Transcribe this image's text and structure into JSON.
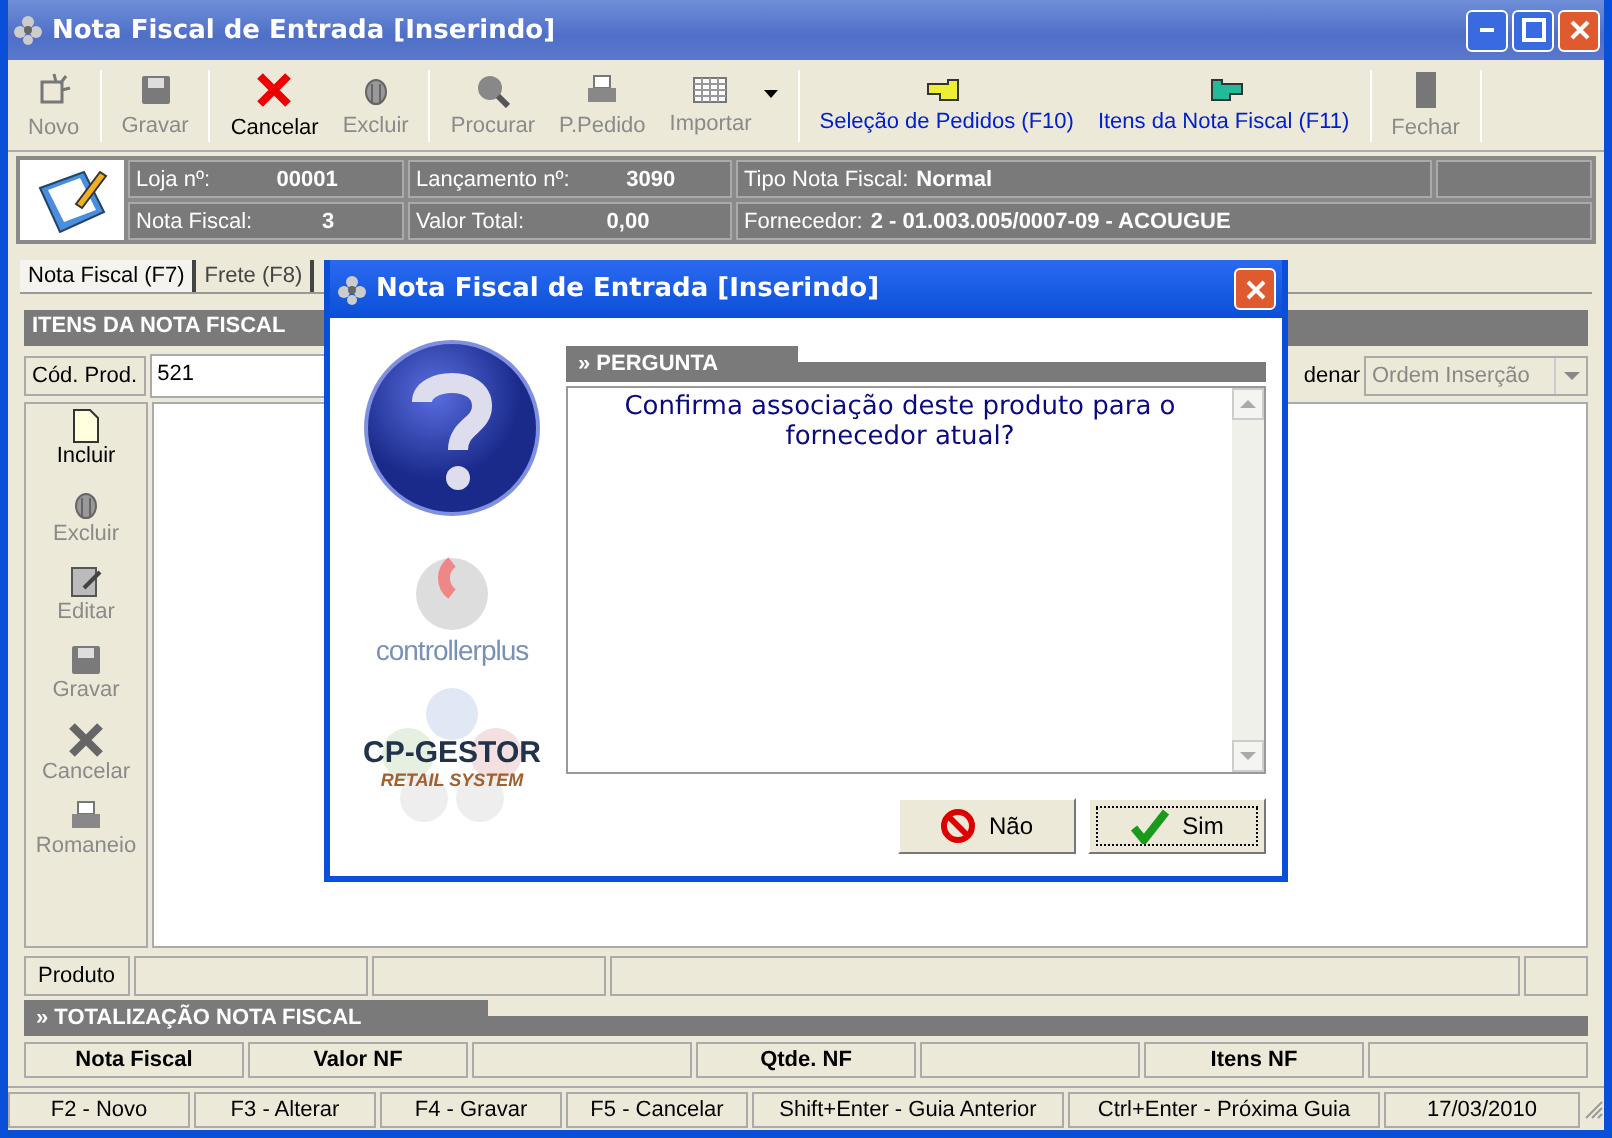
{
  "window": {
    "title": "Nota Fiscal de Entrada [Inserindo]"
  },
  "toolbar": [
    {
      "label": "Novo",
      "kind": "new",
      "disabled": true
    },
    {
      "label": "Gravar",
      "kind": "save",
      "disabled": true
    },
    {
      "label": "Cancelar",
      "kind": "cancel",
      "disabled": false
    },
    {
      "label": "Excluir",
      "kind": "delete",
      "disabled": true
    },
    {
      "label": "Procurar",
      "kind": "search",
      "disabled": true
    },
    {
      "label": "P.Pedido",
      "kind": "print",
      "disabled": true
    },
    {
      "label": "Importar",
      "kind": "import",
      "disabled": true
    },
    {
      "label": "Seleção de Pedidos (F10)",
      "kind": "hand-left",
      "disabled": false
    },
    {
      "label": "Itens da Nota Fiscal (F11)",
      "kind": "hand-right",
      "disabled": false
    },
    {
      "label": "Fechar",
      "kind": "close",
      "disabled": true
    }
  ],
  "info": [
    [
      {
        "label": "Loja nº:",
        "value": "00001"
      },
      {
        "label": "Lançamento nº:",
        "value": "3090"
      },
      {
        "label": "Tipo Nota Fiscal:",
        "value": "Normal"
      }
    ],
    [
      {
        "label": "Nota Fiscal:",
        "value": "3"
      },
      {
        "label": "Valor Total:",
        "value": "0,00"
      },
      {
        "label": "Fornecedor:",
        "value": "2 - 01.003.005/0007-09 - ACOUGUE"
      }
    ]
  ],
  "tabs": [
    {
      "label": "Nota Fiscal (F7)",
      "selected": true
    },
    {
      "label": "Frete (F8)",
      "selected": false
    }
  ],
  "items_section": {
    "title": "ITENS DA NOTA FISCAL",
    "product_code_label": "Cód. Prod.",
    "product_code": "521",
    "order_label": "denar",
    "order_value": "Ordem Inserção"
  },
  "side_actions": [
    {
      "label": "Incluir",
      "kind": "add",
      "disabled": false
    },
    {
      "label": "Excluir",
      "kind": "delete",
      "disabled": true
    },
    {
      "label": "Editar",
      "kind": "edit",
      "disabled": true
    },
    {
      "label": "Gravar",
      "kind": "save",
      "disabled": true
    },
    {
      "label": "Cancelar",
      "kind": "cancel",
      "disabled": true
    },
    {
      "label": "Romaneio",
      "kind": "print",
      "disabled": true
    }
  ],
  "product_row": {
    "label": "Produto"
  },
  "totals": {
    "title": "» TOTALIZAÇÃO NOTA FISCAL",
    "columns": [
      "Nota Fiscal",
      "Valor NF",
      "",
      "Qtde. NF",
      "",
      "Itens NF",
      ""
    ]
  },
  "status_bar": [
    "F2 - Novo",
    "F3 - Alterar",
    "F4 - Gravar",
    "F5 - Cancelar",
    "Shift+Enter - Guia Anterior",
    "Ctrl+Enter - Próxima Guia",
    "17/03/2010"
  ],
  "dialog": {
    "title": "Nota Fiscal de Entrada [Inserindo]",
    "logo_1": "controllerplus",
    "logo_2": "CP-GESTOR",
    "logo_2_sub": "RETAIL SYSTEM",
    "header": "» PERGUNTA",
    "message": "Confirma associação deste produto para o fornecedor atual?",
    "buttons": [
      {
        "label": "Não",
        "kind": "no",
        "focused": false
      },
      {
        "label": "Sim",
        "kind": "yes",
        "focused": true
      }
    ]
  }
}
